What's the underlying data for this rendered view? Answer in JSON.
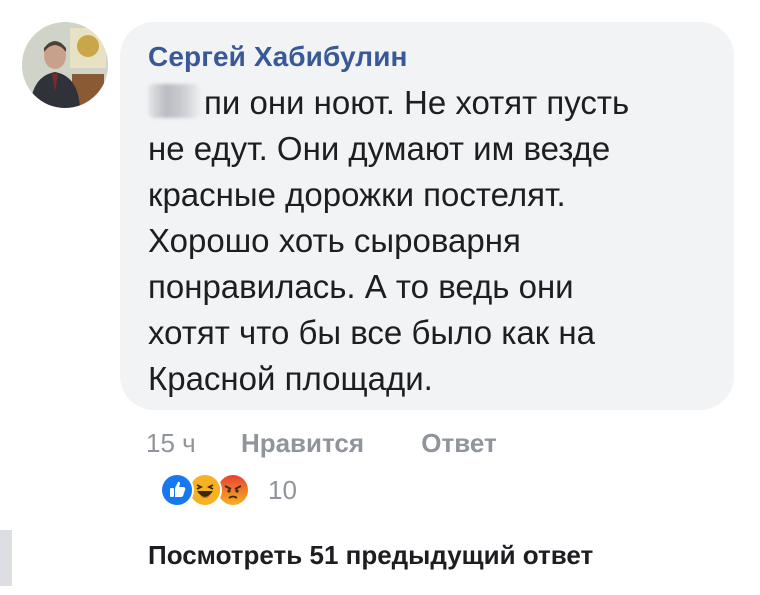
{
  "comment": {
    "author": "Сергей Хабибулин",
    "lines": [
      "пи они ноют. Не хотят пусть",
      "не едут. Они думают им везде",
      "красные дорожки постелят.",
      "Хорошо хоть сыроварня",
      "понравилась. А то ведь они",
      "хотят что бы все было как на",
      "Красной площади."
    ],
    "first_word_redacted": true
  },
  "actions": {
    "time": "15 ч",
    "like_label": "Нравится",
    "reply_label": "Ответ"
  },
  "reactions": {
    "icons": [
      "like-icon",
      "haha-icon",
      "angry-icon"
    ],
    "count": "10"
  },
  "more_replies_label": "Посмотреть 51 предыдущий ответ",
  "colors": {
    "author": "#385898",
    "bubble": "#f2f3f5",
    "meta": "#90949c",
    "like": "#1877f2",
    "haha": "#f7b125",
    "angry": "#e9710f"
  }
}
